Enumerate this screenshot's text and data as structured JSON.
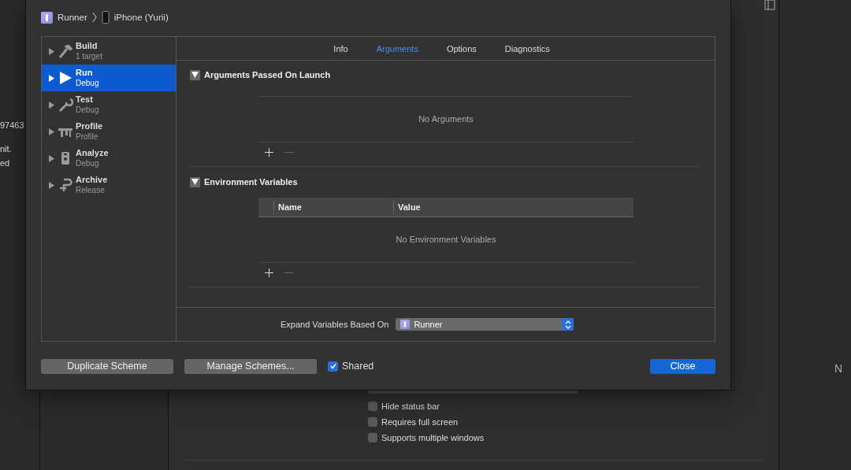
{
  "background": {
    "fragments": [
      "97463",
      "nit.",
      "ed"
    ],
    "right_fragment": "N",
    "checkboxes": [
      {
        "label": "Hide status bar",
        "checked": false
      },
      {
        "label": "Requires full screen",
        "checked": false
      },
      {
        "label": "Supports multiple windows",
        "checked": false
      }
    ]
  },
  "breadcrumb": {
    "scheme": "Runner",
    "device": "iPhone (Yurii)"
  },
  "schemes": [
    {
      "kind": "build",
      "title": "Build",
      "subtitle": "1 target",
      "selected": false
    },
    {
      "kind": "run",
      "title": "Run",
      "subtitle": "Debug",
      "selected": true
    },
    {
      "kind": "test",
      "title": "Test",
      "subtitle": "Debug",
      "selected": false
    },
    {
      "kind": "profile",
      "title": "Profile",
      "subtitle": "Profile",
      "selected": false
    },
    {
      "kind": "analyze",
      "title": "Analyze",
      "subtitle": "Debug",
      "selected": false
    },
    {
      "kind": "archive",
      "title": "Archive",
      "subtitle": "Release",
      "selected": false
    }
  ],
  "tabs": [
    {
      "label": "Info",
      "selected": false
    },
    {
      "label": "Arguments",
      "selected": true
    },
    {
      "label": "Options",
      "selected": false
    },
    {
      "label": "Diagnostics",
      "selected": false
    }
  ],
  "arguments": {
    "title": "Arguments Passed On Launch",
    "expanded": true,
    "empty": "No Arguments"
  },
  "environment": {
    "title": "Environment Variables",
    "expanded": true,
    "columns": [
      "Name",
      "Value"
    ],
    "empty": "No Environment Variables"
  },
  "expand_variables": {
    "label": "Expand Variables Based On",
    "value": "Runner"
  },
  "buttons": [
    "Duplicate Scheme",
    "Manage Schemes..."
  ],
  "shared": {
    "label": "Shared",
    "checked": true
  },
  "close": "Close"
}
